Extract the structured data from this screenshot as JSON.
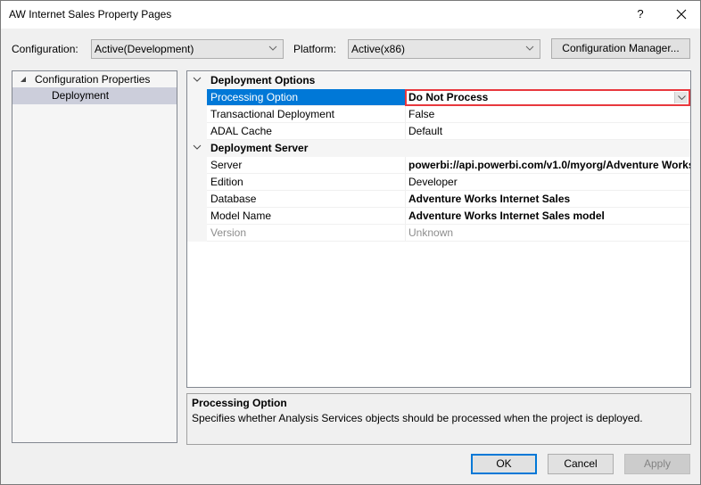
{
  "window": {
    "title": "AW Internet Sales Property Pages",
    "help_label": "?",
    "close_icon": "close-icon"
  },
  "toolbar": {
    "configuration_label": "Configuration:",
    "configuration_value": "Active(Development)",
    "platform_label": "Platform:",
    "platform_value": "Active(x86)",
    "config_manager_label": "Configuration Manager..."
  },
  "tree": {
    "root": "Configuration Properties",
    "items": [
      {
        "label": "Deployment",
        "selected": true
      }
    ]
  },
  "property_grid": {
    "categories": [
      {
        "name": "Deployment Options",
        "properties": [
          {
            "name": "Processing Option",
            "value": "Do Not Process",
            "bold": true,
            "selected": true,
            "editing": true
          },
          {
            "name": "Transactional Deployment",
            "value": "False"
          },
          {
            "name": "ADAL Cache",
            "value": "Default"
          }
        ]
      },
      {
        "name": "Deployment Server",
        "properties": [
          {
            "name": "Server",
            "value": "powerbi://api.powerbi.com/v1.0/myorg/Adventure Works",
            "bold": true
          },
          {
            "name": "Edition",
            "value": "Developer"
          },
          {
            "name": "Database",
            "value": "Adventure Works Internet Sales",
            "bold": true
          },
          {
            "name": "Model Name",
            "value": "Adventure Works Internet Sales model",
            "bold": true
          },
          {
            "name": "Version",
            "value": "Unknown",
            "disabled": true
          }
        ]
      }
    ]
  },
  "description": {
    "title": "Processing Option",
    "text": "Specifies whether Analysis Services objects should be processed when the project is deployed."
  },
  "buttons": {
    "ok": "OK",
    "cancel": "Cancel",
    "apply": "Apply"
  },
  "colors": {
    "selection": "#0078d7",
    "edit_highlight": "#e8383d"
  }
}
